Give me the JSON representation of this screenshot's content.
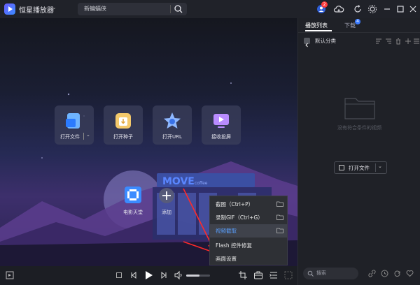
{
  "titlebar": {
    "app_name": "恒星播放器",
    "search_value": "新蝙蝠侠",
    "notification_badge": "2"
  },
  "main": {
    "tiles": [
      {
        "label": "打开文件",
        "icon": "file-open-icon"
      },
      {
        "label": "打开种子",
        "icon": "seed-download-icon"
      },
      {
        "label": "打开URL",
        "icon": "star-url-icon"
      },
      {
        "label": "接收投屏",
        "icon": "cast-receive-icon"
      }
    ],
    "bottom_items": [
      {
        "label": "电影天堂",
        "icon": "film-icon"
      },
      {
        "label": "添加",
        "icon": "plus-icon"
      }
    ],
    "scene_sign": {
      "title": "MOVE",
      "subtitle": "coffee"
    }
  },
  "context_menu": {
    "items": [
      {
        "label": "截图（Ctrl+P）",
        "has_folder": true
      },
      {
        "label": "录制GIF（Ctrl+G）",
        "has_folder": true
      },
      {
        "label": "视频截取",
        "has_folder": true,
        "highlighted": true
      },
      {
        "label": "Flash 控件修复",
        "has_folder": false
      },
      {
        "label": "画面设置",
        "has_folder": false
      }
    ]
  },
  "controls": {
    "icons": [
      "playlist-toggle-icon",
      "stop-icon",
      "prev-icon",
      "play-icon",
      "next-icon",
      "volume-icon",
      "screenshot-tool-icon",
      "toolbox-icon",
      "list-icon",
      "fullscreen-icon"
    ],
    "volume_level": 0.55
  },
  "panel": {
    "tabs": [
      {
        "label": "播放列表",
        "active": true
      },
      {
        "label": "下载",
        "badge": "4"
      }
    ],
    "category": "默认分类",
    "empty_text": "没有符合条件的视频",
    "open_file_label": "打开文件",
    "search_placeholder": "搜索"
  },
  "colors": {
    "accent": "#3b7bff",
    "badge_red": "#ff3b3b",
    "menu_bg": "#2e3035",
    "menu_highlight": "#3f424b",
    "highlight_text": "#5aa0ff"
  }
}
